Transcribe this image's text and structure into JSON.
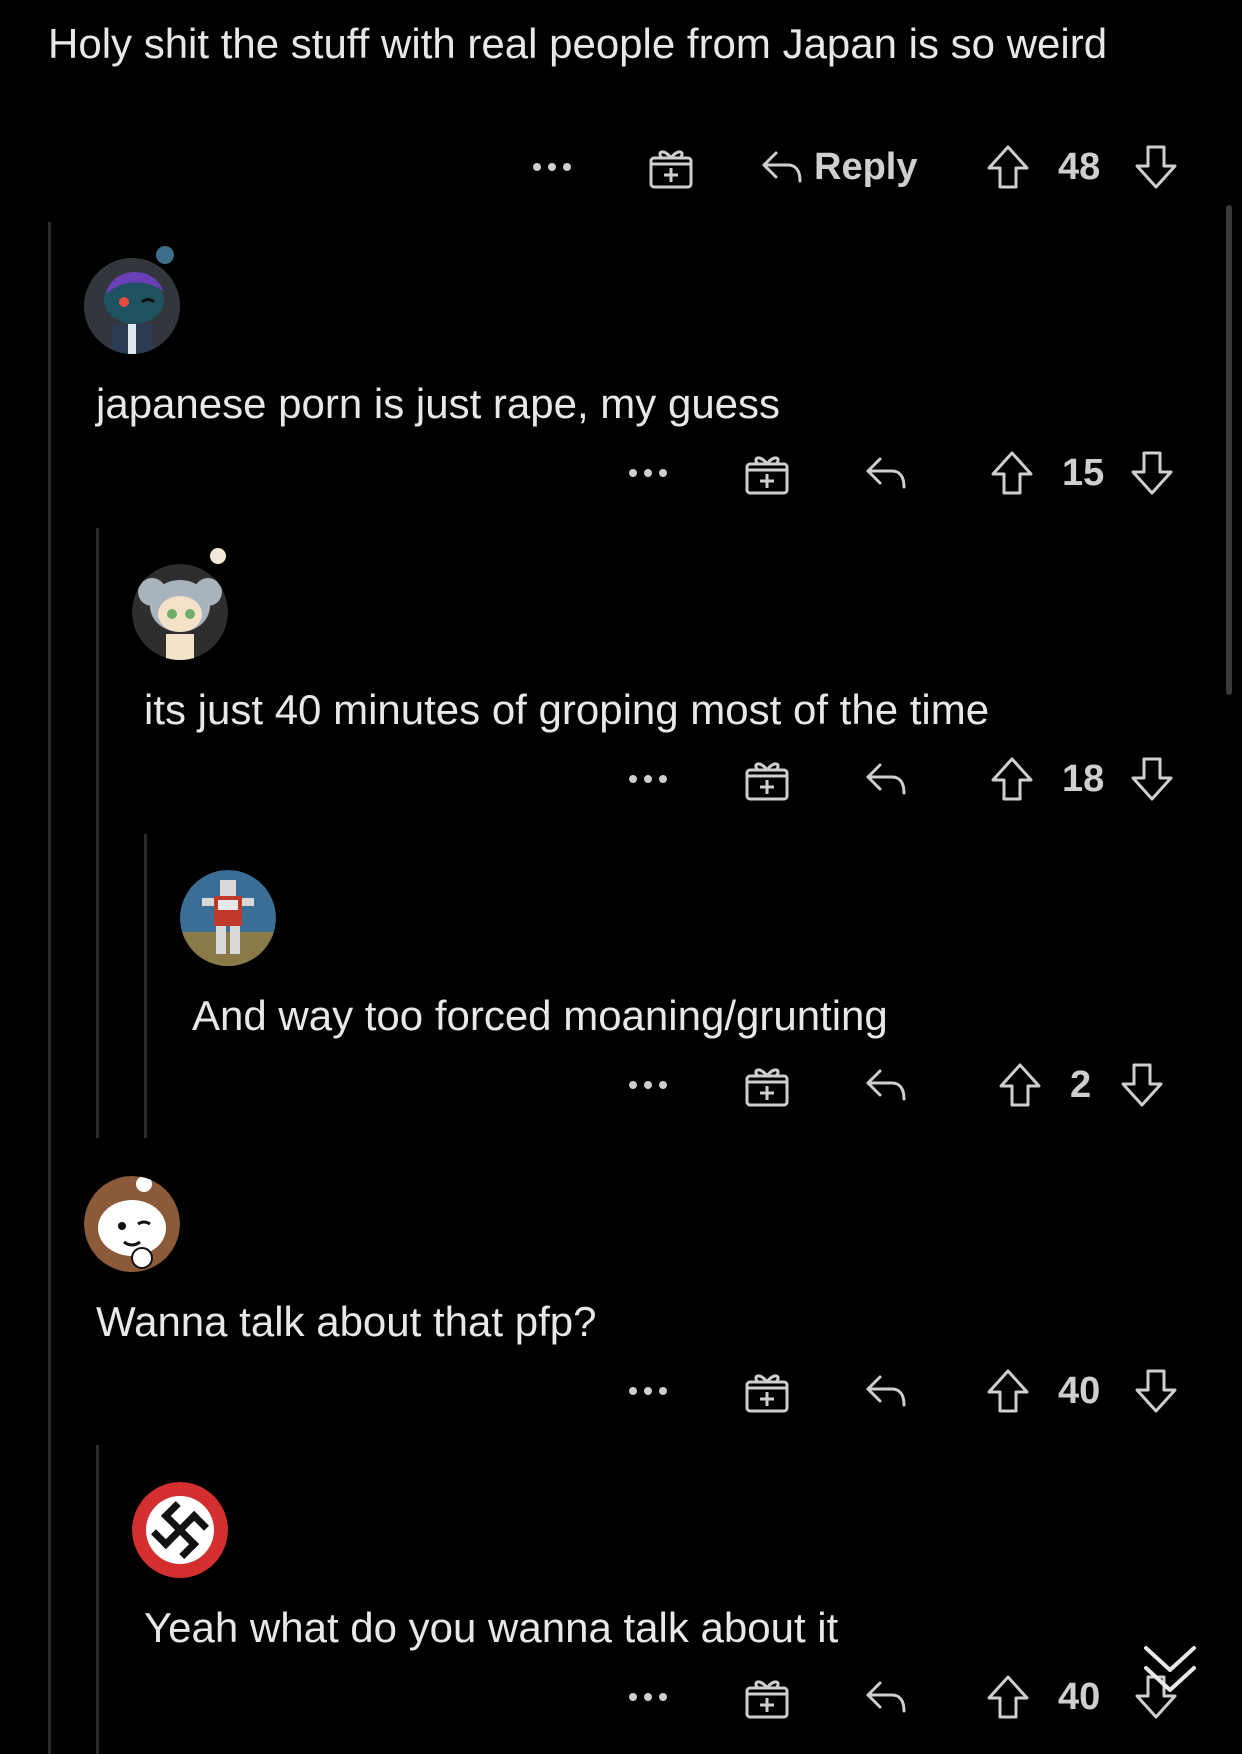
{
  "parent": {
    "text": "Holy shit the stuff with real people from Japan is so weird",
    "reply_label": "Reply",
    "score": "48"
  },
  "comments": [
    {
      "text": "japanese porn is just rape, my guess",
      "score": "15",
      "avatar": "purple-hair-snoo-avatar"
    },
    {
      "text": "its just 40 minutes of groping most of the time",
      "score": "18",
      "avatar": "koala-hood-snoo-avatar"
    },
    {
      "text": "And way too forced moaning/grunting",
      "score": "2",
      "avatar": "robot-hero-avatar"
    },
    {
      "text": "Wanna talk about that pfp?",
      "score": "40",
      "avatar": "brown-snoo-avatar"
    },
    {
      "text": "Yeah what do you wanna talk about it",
      "score": "40",
      "avatar": "nazi-symbol-avatar"
    }
  ],
  "icons": {
    "more": "more-dots-icon",
    "award": "gift-award-icon",
    "reply": "reply-arrow-icon",
    "upvote": "upvote-arrow-icon",
    "downvote": "downvote-arrow-icon",
    "collapse": "chevrons-down-icon"
  },
  "colors": {
    "background": "#000000",
    "text": "#e8e8e8",
    "icon": "#cfcfcf",
    "thread_line": "#2b2b2b"
  }
}
